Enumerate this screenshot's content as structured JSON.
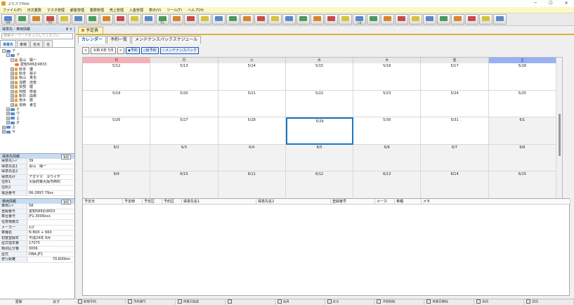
{
  "window": {
    "title": "ぷらスマWeb"
  },
  "menu": [
    "ファイル(F)",
    "日次業務",
    "マスタ管理",
    "顧客管理",
    "業務管理",
    "売上管理",
    "入金管理",
    "表示(V)",
    "ツール(T)",
    "ヘルプ(H)"
  ],
  "toolbar": [
    "新規",
    "",
    "",
    "予定",
    "",
    "",
    "",
    "",
    "",
    "",
    "",
    "売上",
    "",
    "",
    "",
    "",
    "",
    "",
    "",
    "",
    "",
    "",
    "",
    "",
    "",
    "入金",
    "",
    "",
    "",
    "",
    "",
    "",
    "",
    "",
    "",
    ""
  ],
  "left": {
    "header": "得意先・車両情報",
    "search_placeholder": "検索キーワードを入力してください",
    "tabs": [
      "得意先",
      "車検",
      "定点",
      "任"
    ],
    "tree": [
      {
        "level": 0,
        "kind": "folder",
        "text": "ア",
        "open": true
      },
      {
        "level": 1,
        "kind": "folder",
        "text": "ア",
        "open": true
      },
      {
        "level": 2,
        "kind": "person",
        "text": "青山　陽一",
        "open": true
      },
      {
        "level": 3,
        "kind": "car",
        "text": "愛知588お9833"
      },
      {
        "level": 2,
        "kind": "person",
        "text": "秋本　優"
      },
      {
        "level": 2,
        "kind": "person",
        "text": "秋本　裕子"
      },
      {
        "level": 2,
        "kind": "person",
        "text": "秋山　真也"
      },
      {
        "level": 2,
        "kind": "person",
        "text": "浅野　佳恵"
      },
      {
        "level": 2,
        "kind": "person",
        "text": "安部　健"
      },
      {
        "level": 2,
        "kind": "person",
        "text": "阿部　修幸"
      },
      {
        "level": 2,
        "kind": "person",
        "text": "新井　由那"
      },
      {
        "level": 2,
        "kind": "person",
        "text": "荒木　剛"
      },
      {
        "level": 2,
        "kind": "person",
        "text": "安西　孝生"
      },
      {
        "level": 1,
        "kind": "folder",
        "text": "イ"
      },
      {
        "level": 1,
        "kind": "folder",
        "text": "ウ"
      },
      {
        "level": 1,
        "kind": "folder",
        "text": "エ"
      },
      {
        "level": 1,
        "kind": "folder",
        "text": "オ"
      },
      {
        "level": 0,
        "kind": "folder",
        "text": "カ"
      },
      {
        "level": 0,
        "kind": "folder",
        "text": "サ"
      }
    ],
    "customer": {
      "title": "得意先情報",
      "btn": "参照",
      "rows": [
        {
          "k": "得意先ｺｰﾄﾞ",
          "v": "39"
        },
        {
          "k": "得意先名1",
          "v": "青山　陽一"
        },
        {
          "k": "得意先名2",
          "v": ""
        },
        {
          "k": "得意先ｶﾅ",
          "v": "アオヤマ　ヨウイチ"
        },
        {
          "k": "住所1",
          "v": "大阪府東大阪市西石"
        },
        {
          "k": "住所2",
          "v": ""
        },
        {
          "k": "電話番号",
          "v": "06-2897-79xx"
        }
      ]
    },
    "vehicle": {
      "title": "車両情報",
      "btn": "参照",
      "rows": [
        {
          "k": "車両ｺｰﾄﾞ",
          "v": "58"
        },
        {
          "k": "登録番号",
          "v": "愛知588お9833"
        },
        {
          "k": "車台番号",
          "v": "JF1-3009xxx"
        },
        {
          "k": "任意検索文",
          "v": ""
        },
        {
          "k": "メーカー",
          "v": "ﾎﾝﾀﾞ"
        },
        {
          "k": "車種名",
          "v": "N BOX + 660"
        },
        {
          "k": "初度登録年",
          "v": "平成24年 9月"
        },
        {
          "k": "型式指定番",
          "v": "17075"
        },
        {
          "k": "類別区分番",
          "v": "0006"
        },
        {
          "k": "型式",
          "v": "DBA-JF1"
        },
        {
          "k": "走行距離",
          "v": "70,600km",
          "r": true
        }
      ]
    },
    "bottom": [
      "更新",
      "戻す"
    ]
  },
  "main": {
    "doc_tab": "予定表",
    "subtabs": [
      "カレンダー",
      "予約一覧",
      "メンテナンスパックスケジュール"
    ],
    "controls": [
      "<",
      "令和 6年 5月",
      ">",
      "◆予約",
      "◇仮予約",
      "☆メンテナンスパック"
    ],
    "weekdays": [
      "日",
      "月",
      "火",
      "水",
      "木",
      "金",
      "土"
    ],
    "weeks": [
      [
        "5/12",
        "5/13",
        "5/14",
        "5/15",
        "5/16",
        "5/17",
        "5/18"
      ],
      [
        "5/19",
        "5/20",
        "5/21",
        "5/22",
        "5/23",
        "5/24",
        "5/25"
      ],
      [
        "5/26",
        "5/27",
        "5/28",
        "5/29",
        "5/30",
        "5/31",
        "6/1"
      ],
      [
        "6/2",
        "6/3",
        "6/4",
        "6/5",
        "6/6",
        "6/7",
        "6/8"
      ],
      [
        "6/9",
        "6/10",
        "6/11",
        "6/12",
        "6/13",
        "6/14",
        "6/15"
      ]
    ],
    "list_headers": [
      "予定日",
      "予定時",
      "予定区",
      "予約区",
      "得意先名1",
      "得意先名2",
      "登録番号",
      "メーカ",
      "車種",
      "メモ"
    ],
    "bottom_buttons": [
      "新規予約",
      "予約複写",
      "休業日設定",
      "",
      "当月",
      "戻る",
      "予約削除",
      "休業日解除",
      "前月",
      "翌月"
    ]
  }
}
